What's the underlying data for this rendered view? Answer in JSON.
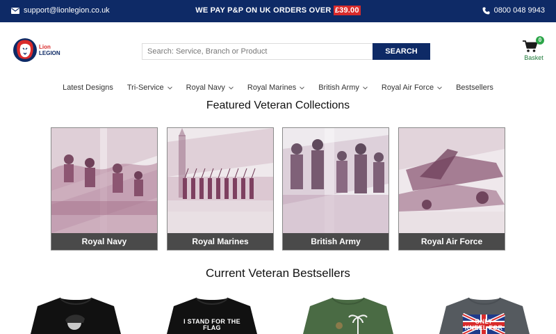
{
  "topbar": {
    "email": "support@lionlegion.co.uk",
    "promo_text": "WE PAY P&P ON UK ORDERS OVER",
    "promo_price": "£39.00",
    "phone": "0800 048 9943"
  },
  "logo": {
    "line1": "Lion",
    "line2": "LEGION"
  },
  "search": {
    "placeholder": "Search: Service, Branch or Product",
    "button_label": "SEARCH"
  },
  "basket": {
    "count": "0",
    "label": "Basket"
  },
  "nav": {
    "items": [
      {
        "label": "Latest Designs"
      },
      {
        "label": "Tri-Service"
      },
      {
        "label": "Royal Navy"
      },
      {
        "label": "Royal Marines"
      },
      {
        "label": "British Army"
      },
      {
        "label": "Royal Air Force"
      },
      {
        "label": "Bestsellers"
      }
    ]
  },
  "featured": {
    "heading": "Featured Veteran Collections",
    "cards": [
      {
        "label": "Royal Navy"
      },
      {
        "label": "Royal Marines"
      },
      {
        "label": "British Army"
      },
      {
        "label": "Royal Air Force"
      }
    ]
  },
  "bestsellers": {
    "heading": "Current Veteran Bestsellers",
    "products": [
      {
        "print": "",
        "shirt_color": "#111111"
      },
      {
        "print": "I STAND FOR THE FLAG",
        "shirt_color": "#111111"
      },
      {
        "print": "",
        "shirt_color": "#4a6b44"
      },
      {
        "print": "ONLY KNEEL FOR",
        "shirt_color": "#555a5f"
      }
    ]
  },
  "colors": {
    "navy": "#0e2a66",
    "accent_red": "#d92b2b",
    "basket_green": "#2da64a",
    "caption_bg": "#4a4a4a"
  }
}
